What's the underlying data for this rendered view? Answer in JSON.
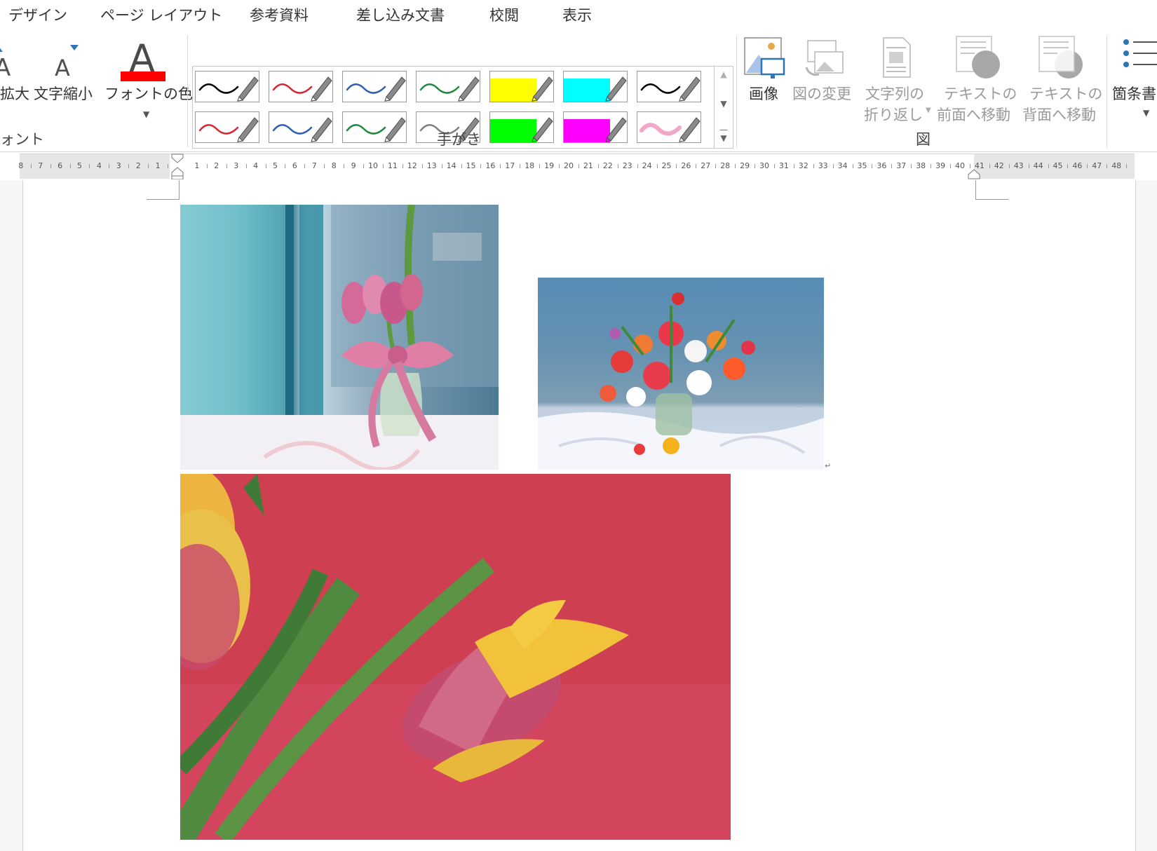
{
  "tabs": [
    {
      "label": "デザイン"
    },
    {
      "label": "ページ レイアウト"
    },
    {
      "label": "参考資料"
    },
    {
      "label": "差し込み文書"
    },
    {
      "label": "校閲"
    },
    {
      "label": "表示"
    }
  ],
  "ribbon": {
    "font_group": {
      "grow_label": "拡大",
      "shrink_label": "文字縮小",
      "font_color_label": "フォントの色",
      "group_label": "ォント",
      "font_color": "#ff0000"
    },
    "ink_group": {
      "group_label": "手がき",
      "pens": [
        {
          "color": "#000000",
          "style": "pen"
        },
        {
          "color": "#d9262e",
          "style": "pen"
        },
        {
          "color": "#2e5fb5",
          "style": "pen"
        },
        {
          "color": "#1f8a3c",
          "style": "pen"
        },
        {
          "color": "#ffff00",
          "style": "highlighter"
        },
        {
          "color": "#00ffff",
          "style": "highlighter"
        },
        {
          "color": "#000000",
          "style": "pen"
        },
        {
          "color": "#d9262e",
          "style": "pen"
        },
        {
          "color": "#2e5fb5",
          "style": "pen"
        },
        {
          "color": "#1f8a3c",
          "style": "pen"
        },
        {
          "color": "#808080",
          "style": "pen"
        },
        {
          "color": "#00ff00",
          "style": "highlighter"
        },
        {
          "color": "#ff00ff",
          "style": "highlighter"
        },
        {
          "color": "#f2a6c8",
          "style": "pen"
        }
      ]
    },
    "picture_group": {
      "image_label": "画像",
      "change_label": "図の変更",
      "wrap_label_1": "文字列の",
      "wrap_label_2": "折り返し",
      "front_label_1": "テキストの",
      "front_label_2": "前面へ移動",
      "back_label_1": "テキストの",
      "back_label_2": "背面へ移動",
      "group_label": "図"
    },
    "list_label": "箇条書"
  },
  "ruler": {
    "left_numbers": [
      "8",
      "7",
      "6",
      "5",
      "4",
      "3",
      "2",
      "1"
    ],
    "right_numbers": [
      "1",
      "2",
      "3",
      "4",
      "5",
      "6",
      "7",
      "8",
      "9",
      "10",
      "11",
      "12",
      "13",
      "14",
      "15",
      "16",
      "17",
      "18",
      "19",
      "20",
      "21",
      "22",
      "23",
      "24",
      "25",
      "26",
      "27",
      "28",
      "29",
      "30",
      "31",
      "32",
      "33",
      "34",
      "35",
      "36",
      "37",
      "38",
      "39",
      "40",
      "41",
      "42",
      "43",
      "44",
      "45",
      "46",
      "47",
      "48"
    ]
  },
  "document": {
    "paragraph_mark": "↵"
  },
  "icons": {
    "grow": "grow-font-icon",
    "shrink": "shrink-font-icon",
    "font_color": "font-color-icon",
    "image": "image-icon",
    "change": "change-picture-icon",
    "wrap": "wrap-text-icon",
    "front": "bring-forward-icon",
    "back": "send-backward-icon",
    "list": "bullets-icon"
  }
}
